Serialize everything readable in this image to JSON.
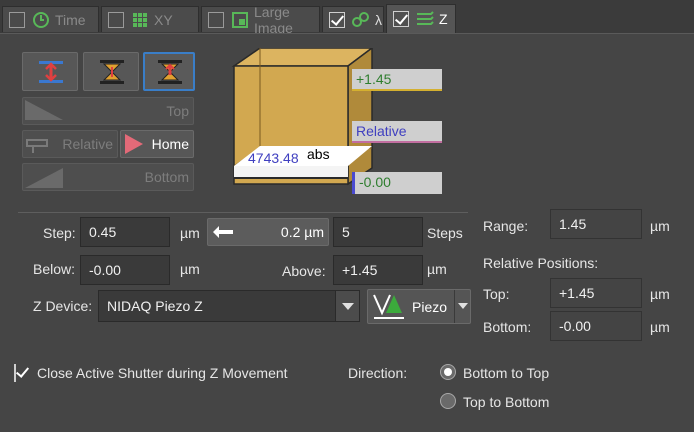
{
  "tabs": [
    {
      "label": "Time",
      "checked": false,
      "active": false,
      "icon": "clock-icon"
    },
    {
      "label": "XY",
      "checked": false,
      "active": false,
      "icon": "grid-icon"
    },
    {
      "label": "Large Image",
      "checked": false,
      "active": false,
      "icon": "large-image-icon"
    },
    {
      "label": "λ",
      "checked": true,
      "active": false,
      "icon": "wavelength-icon"
    },
    {
      "label": "Z",
      "checked": true,
      "active": true,
      "icon": "z-stack-icon"
    }
  ],
  "z_buttons": {
    "top": "Top",
    "relative": "Relative",
    "home": "Home",
    "bottom": "Bottom"
  },
  "cube": {
    "top_value": "+1.45",
    "relative_label": "Relative",
    "current_value": "4743.48",
    "abs_label": "abs",
    "bottom_value": "-0.00"
  },
  "step": {
    "label": "Step:",
    "value": "0.45",
    "unit": "µm",
    "stepper_value": "0.2 µm",
    "steps_value": "5",
    "steps_label": "Steps"
  },
  "below": {
    "label": "Below:",
    "value": "-0.00",
    "unit": "µm"
  },
  "above": {
    "label": "Above:",
    "value": "+1.45",
    "unit": "µm"
  },
  "device": {
    "label": "Z Device:",
    "value": "NIDAQ Piezo Z",
    "type_label": "Piezo"
  },
  "range": {
    "label": "Range:",
    "value": "1.45",
    "unit": "µm"
  },
  "relative_positions": {
    "label": "Relative Positions:",
    "top_label": "Top:",
    "top_value": "+1.45",
    "bottom_label": "Bottom:",
    "bottom_value": "-0.00",
    "unit": "µm"
  },
  "shutter": {
    "label": "Close Active Shutter during Z Movement",
    "checked": true
  },
  "direction": {
    "label": "Direction:",
    "options": [
      "Bottom to Top",
      "Top to Bottom"
    ],
    "selected": "Bottom to Top"
  },
  "colors": {
    "accent": "#4a86c8",
    "cube": "#c9a24a",
    "green_text": "#3a9a3a",
    "blue_text": "#4040c0"
  }
}
